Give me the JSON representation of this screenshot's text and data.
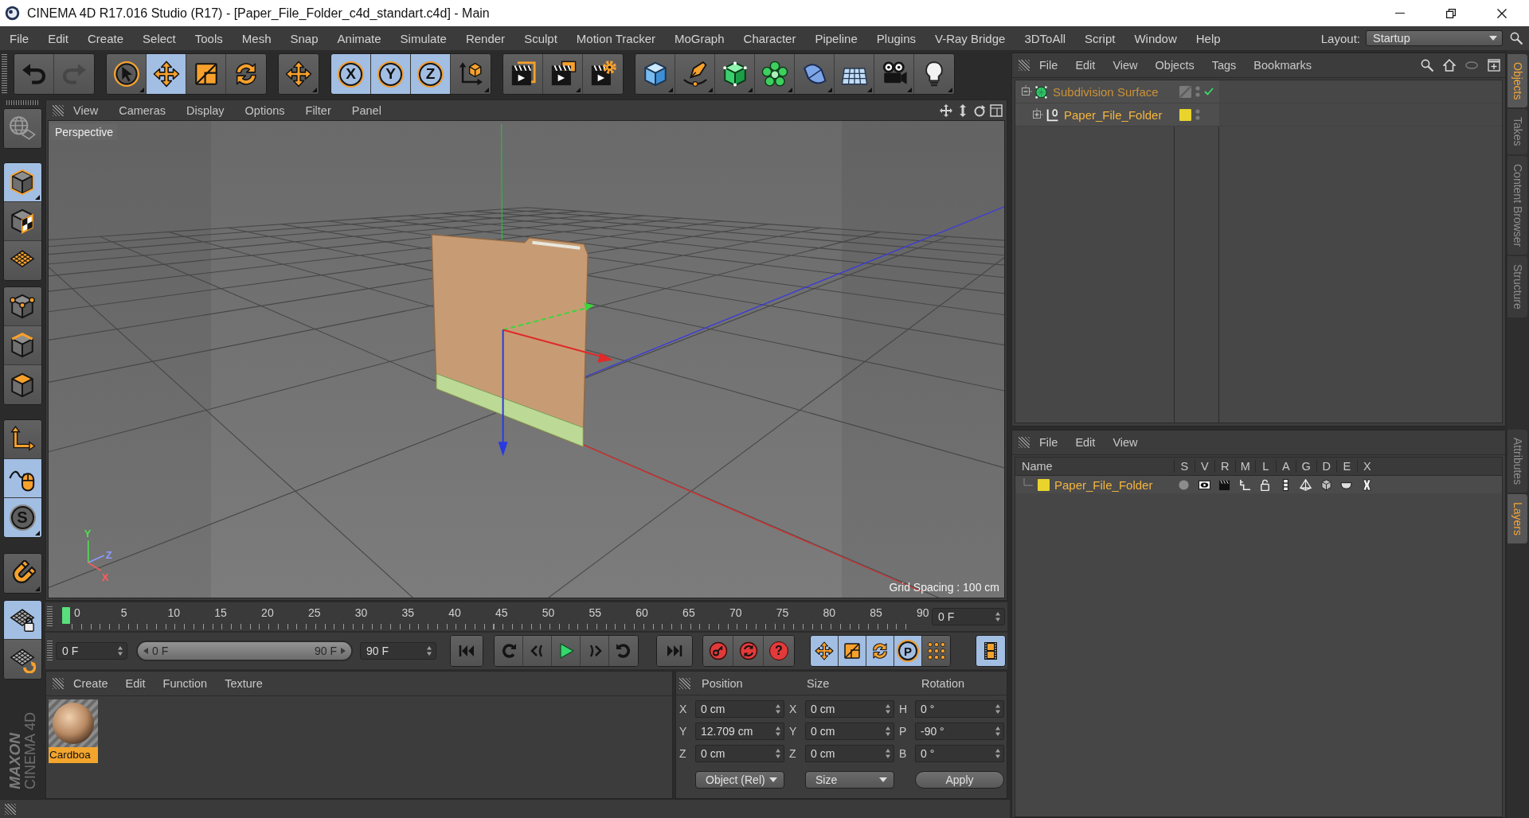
{
  "window": {
    "title": "CINEMA 4D R17.016 Studio (R17) - [Paper_File_Folder_c4d_standart.c4d] - Main"
  },
  "menu_bar": {
    "items": [
      "File",
      "Edit",
      "Create",
      "Select",
      "Tools",
      "Mesh",
      "Snap",
      "Animate",
      "Simulate",
      "Render",
      "Sculpt",
      "Motion Tracker",
      "MoGraph",
      "Character",
      "Pipeline",
      "Plugins",
      "V-Ray Bridge",
      "3DToAll",
      "Script",
      "Window",
      "Help"
    ],
    "layout_label": "Layout:",
    "layout_value": "Startup"
  },
  "toolbar": {
    "groups": [
      [
        {
          "kind": "undo",
          "selected": false,
          "disabled": false,
          "flyout": false
        },
        {
          "kind": "redo",
          "selected": false,
          "disabled": true,
          "flyout": false
        }
      ],
      [
        {
          "kind": "live-selection",
          "selected": false,
          "disabled": false,
          "flyout": true
        },
        {
          "kind": "move",
          "selected": true,
          "disabled": false,
          "flyout": false
        },
        {
          "kind": "scale",
          "selected": false,
          "disabled": false,
          "flyout": false
        },
        {
          "kind": "rotate",
          "selected": false,
          "disabled": false,
          "flyout": false
        }
      ],
      [
        {
          "kind": "move",
          "selected": false,
          "disabled": false,
          "flyout": true
        }
      ],
      [
        {
          "kind": "axis-lock",
          "label": "X",
          "selected": true,
          "disabled": false,
          "flyout": false
        },
        {
          "kind": "axis-lock",
          "label": "Y",
          "selected": true,
          "disabled": false,
          "flyout": false
        },
        {
          "kind": "axis-lock",
          "label": "Z",
          "selected": true,
          "disabled": false,
          "flyout": false
        },
        {
          "kind": "coordinate-system",
          "selected": false,
          "disabled": false,
          "flyout": true
        }
      ],
      [
        {
          "kind": "render-view",
          "selected": false,
          "disabled": false,
          "flyout": false
        },
        {
          "kind": "picture-viewer",
          "selected": false,
          "disabled": false,
          "flyout": true
        },
        {
          "kind": "render-settings",
          "selected": false,
          "disabled": false,
          "flyout": false
        }
      ],
      [
        {
          "kind": "cube",
          "selected": false,
          "disabled": false,
          "flyout": true
        },
        {
          "kind": "pen",
          "selected": false,
          "disabled": false,
          "flyout": true
        },
        {
          "kind": "subdivision",
          "selected": false,
          "disabled": false,
          "flyout": true
        },
        {
          "kind": "cloner",
          "selected": false,
          "disabled": false,
          "flyout": true
        },
        {
          "kind": "deformer",
          "selected": false,
          "disabled": false,
          "flyout": true
        },
        {
          "kind": "floor",
          "selected": false,
          "disabled": false,
          "flyout": true
        },
        {
          "kind": "camera",
          "selected": false,
          "disabled": false,
          "flyout": true
        },
        {
          "kind": "light",
          "selected": false,
          "disabled": false,
          "flyout": true
        }
      ]
    ]
  },
  "left_toolbar": {
    "groups": [
      [
        {
          "kind": "workplane-globe",
          "selected": false,
          "flyout": false
        }
      ],
      [
        {
          "kind": "model",
          "selected": true,
          "flyout": true
        },
        {
          "kind": "texture",
          "selected": false,
          "flyout": false
        },
        {
          "kind": "workplane",
          "selected": false,
          "flyout": false
        }
      ],
      [
        {
          "kind": "points",
          "selected": false,
          "flyout": false
        },
        {
          "kind": "edges",
          "selected": false,
          "flyout": false
        },
        {
          "kind": "polygons",
          "selected": false,
          "flyout": false
        }
      ],
      [
        {
          "kind": "axis",
          "selected": false,
          "flyout": false
        },
        {
          "kind": "tweak",
          "selected": true,
          "flyout": false
        },
        {
          "kind": "snap",
          "label": "S",
          "selected": true,
          "flyout": true
        }
      ],
      [
        {
          "kind": "magnet",
          "selected": false,
          "flyout": true
        }
      ],
      [
        {
          "kind": "grid-lock",
          "selected": true,
          "flyout": false
        },
        {
          "kind": "grid-rotate",
          "selected": false,
          "flyout": false
        }
      ]
    ]
  },
  "logo": {
    "brand": "MAXON",
    "product": "CINEMA 4D"
  },
  "viewport": {
    "menu": [
      "View",
      "Cameras",
      "Display",
      "Options",
      "Filter",
      "Panel"
    ],
    "camera": "Perspective",
    "grid_spacing": "Grid Spacing : 100 cm",
    "axis_labels": [
      {
        "label": "Y",
        "color": "#4fe04f"
      },
      {
        "label": "Z",
        "color": "#8f9bff"
      },
      {
        "label": "X",
        "color": "#ff5c5c"
      }
    ]
  },
  "timeline": {
    "ticks": [
      "0",
      "5",
      "10",
      "15",
      "20",
      "25",
      "30",
      "35",
      "40",
      "45",
      "50",
      "55",
      "60",
      "65",
      "70",
      "75",
      "80",
      "85",
      "90"
    ],
    "level": 0,
    "current_frame": "0 F"
  },
  "playback": {
    "start_frame": "0 F",
    "range": {
      "start": "0 F",
      "end": "90 F",
      "level": 1
    },
    "end_frame": "90 F",
    "groups": [
      [
        {
          "kind": "go-start",
          "selected": false
        }
      ],
      [
        {
          "kind": "prev-key",
          "selected": false
        },
        {
          "kind": "prev-frame",
          "selected": false
        },
        {
          "kind": "play",
          "selected": false
        },
        {
          "kind": "next-frame",
          "selected": false
        },
        {
          "kind": "next-key",
          "selected": false
        }
      ],
      [
        {
          "kind": "go-end",
          "selected": false
        }
      ],
      [
        {
          "kind": "record",
          "selected": false
        },
        {
          "kind": "auto-key",
          "selected": false
        },
        {
          "kind": "key-help",
          "label": "?",
          "selected": false
        }
      ],
      [
        {
          "kind": "key-position",
          "selected": true
        },
        {
          "kind": "key-scale",
          "selected": true
        },
        {
          "kind": "key-rotation",
          "selected": true
        },
        {
          "kind": "key-parameter",
          "label": "P",
          "selected": true
        },
        {
          "kind": "key-points",
          "selected": false
        }
      ],
      [
        {
          "kind": "timeline",
          "selected": true
        }
      ]
    ]
  },
  "material_manager": {
    "menu": [
      "Create",
      "Edit",
      "Function",
      "Texture"
    ],
    "materials": [
      {
        "name": "Cardboa",
        "selected": true
      }
    ]
  },
  "coordinates": {
    "headers": [
      "Position",
      "Size",
      "Rotation"
    ],
    "rows": [
      [
        {
          "axis": "X",
          "value": "0 cm"
        },
        {
          "axis": "X",
          "value": "0 cm"
        },
        {
          "axis": "H",
          "value": "0 °"
        }
      ],
      [
        {
          "axis": "Y",
          "value": "12.709 cm"
        },
        {
          "axis": "Y",
          "value": "0 cm"
        },
        {
          "axis": "P",
          "value": "-90 °"
        }
      ],
      [
        {
          "axis": "Z",
          "value": "0 cm"
        },
        {
          "axis": "Z",
          "value": "0 cm"
        },
        {
          "axis": "B",
          "value": "0 °"
        }
      ]
    ],
    "mode": "Object (Rel)",
    "size_mode": "Size",
    "apply": "Apply"
  },
  "object_manager": {
    "menu": [
      "File",
      "Edit",
      "View",
      "Objects",
      "Tags",
      "Bookmarks"
    ],
    "tree": [
      {
        "name": "Subdivision Surface",
        "kind": "subdivision",
        "expanded": true,
        "selected": true,
        "checked": true,
        "children": [
          {
            "name": "Paper_File_Folder",
            "kind": "null",
            "expanded": false,
            "selected": true,
            "checked": false,
            "color": "#e8d42c"
          }
        ]
      }
    ]
  },
  "layer_manager": {
    "menu": [
      "File",
      "Edit",
      "View"
    ],
    "name_header": "Name",
    "columns": [
      {
        "label": "S",
        "kind": "solo"
      },
      {
        "label": "V",
        "kind": "view"
      },
      {
        "label": "R",
        "kind": "render"
      },
      {
        "label": "M",
        "kind": "manager"
      },
      {
        "label": "L",
        "kind": "lock"
      },
      {
        "label": "A",
        "kind": "animation"
      },
      {
        "label": "G",
        "kind": "generators"
      },
      {
        "label": "D",
        "kind": "deformers"
      },
      {
        "label": "E",
        "kind": "expressions"
      },
      {
        "label": "X",
        "kind": "xref"
      }
    ],
    "rows": [
      {
        "name": "Paper_File_Folder",
        "color": "#e8d42c"
      }
    ]
  },
  "side_tabs": {
    "upper": [
      {
        "label": "Objects",
        "selected": true
      },
      {
        "label": "Takes",
        "selected": false
      },
      {
        "label": "Content Browser",
        "selected": false
      },
      {
        "label": "Structure",
        "selected": false
      }
    ],
    "lower": [
      {
        "label": "Attributes",
        "selected": false
      },
      {
        "label": "Layers",
        "selected": true
      }
    ]
  }
}
